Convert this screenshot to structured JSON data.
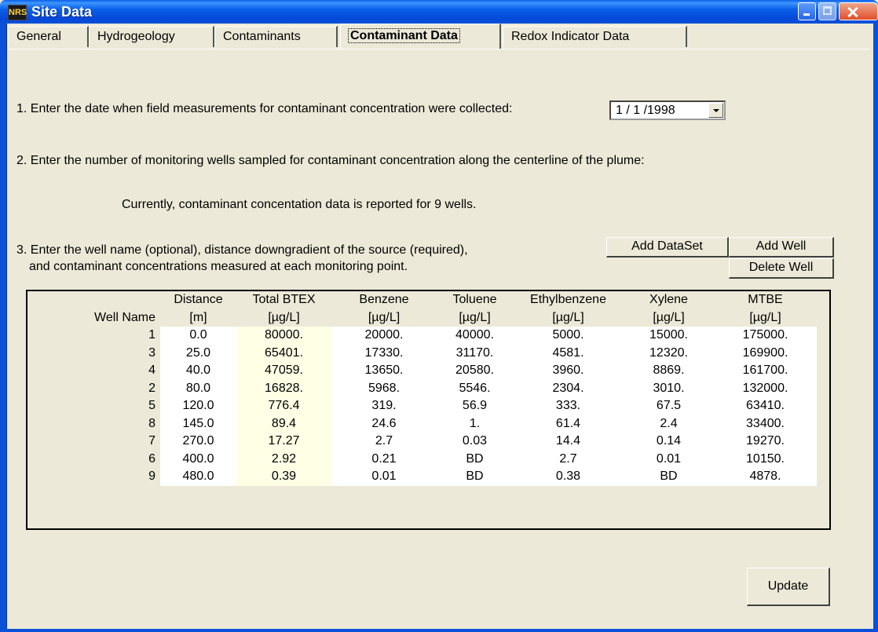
{
  "window": {
    "title": "Site Data",
    "icon": "app-logo-icon"
  },
  "tabs": [
    {
      "label": "General",
      "active": false
    },
    {
      "label": "Hydrogeology",
      "active": false
    },
    {
      "label": "Contaminants",
      "active": false
    },
    {
      "label": "Contaminant Data",
      "active": true
    },
    {
      "label": "Redox Indicator Data",
      "active": false
    }
  ],
  "step1": {
    "label": "1. Enter the date when field measurements for contaminant concentration were collected:",
    "date_value": "1 / 1 /1998"
  },
  "step2": {
    "label": "2. Enter the number of monitoring wells sampled for contaminant concentration along the centerline of the plume:",
    "status": "Currently, contaminant concentation data is reported for 9 wells."
  },
  "step3": {
    "line1": "3. Enter the well name (optional), distance downgradient of the source (required),",
    "line2": "and contaminant concentrations measured at each monitoring point."
  },
  "buttons": {
    "add_dataset": "Add DataSet",
    "add_well": "Add Well",
    "delete_well": "Delete Well",
    "update": "Update"
  },
  "table": {
    "header_row1": [
      "",
      "Distance",
      "Total BTEX",
      "Benzene",
      "Toluene",
      "Ethylbenzene",
      "Xylene",
      "MTBE"
    ],
    "header_row2": [
      "Well Name",
      "[m]",
      "[µg/L]",
      "[µg/L]",
      "[µg/L]",
      "[µg/L]",
      "[µg/L]",
      "[µg/L]"
    ],
    "rows": [
      [
        "1",
        "0.0",
        "80000.",
        "20000.",
        "40000.",
        "5000.",
        "15000.",
        "175000."
      ],
      [
        "3",
        "25.0",
        "65401.",
        "17330.",
        "31170.",
        "4581.",
        "12320.",
        "169900."
      ],
      [
        "4",
        "40.0",
        "47059.",
        "13650.",
        "20580.",
        "3960.",
        "8869.",
        "161700."
      ],
      [
        "2",
        "80.0",
        "16828.",
        "5968.",
        "5546.",
        "2304.",
        "3010.",
        "132000."
      ],
      [
        "5",
        "120.0",
        "776.4",
        "319.",
        "56.9",
        "333.",
        "67.5",
        "63410."
      ],
      [
        "8",
        "145.0",
        "89.4",
        "24.6",
        "1.",
        "61.4",
        "2.4",
        "33400."
      ],
      [
        "7",
        "270.0",
        "17.27",
        "2.7",
        "0.03",
        "14.4",
        "0.14",
        "19270."
      ],
      [
        "6",
        "400.0",
        "2.92",
        "0.21",
        "BD",
        "2.7",
        "0.01",
        "10150."
      ],
      [
        "9",
        "480.0",
        "0.39",
        "0.01",
        "BD",
        "0.38",
        "BD",
        "4878."
      ]
    ]
  },
  "colors": {
    "titlebar": "#0A5FE8",
    "face": "#ECE9D8",
    "btex_column": "#FFFFE6"
  }
}
